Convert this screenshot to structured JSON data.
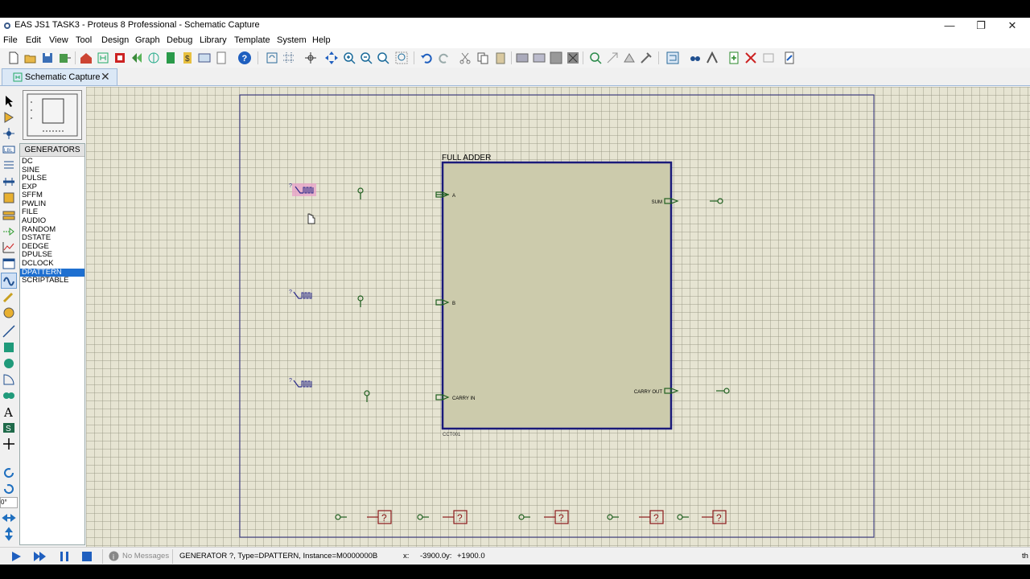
{
  "window": {
    "title": "EAS JS1 TASK3 - Proteus 8 Professional - Schematic Capture"
  },
  "menu": [
    "File",
    "Edit",
    "View",
    "Tool",
    "Design",
    "Graph",
    "Debug",
    "Library",
    "Template",
    "System",
    "Help"
  ],
  "tab": {
    "label": "Schematic Capture"
  },
  "generators": {
    "header": "GENERATORS",
    "items": [
      "DC",
      "SINE",
      "PULSE",
      "EXP",
      "SFFM",
      "PWLIN",
      "FILE",
      "AUDIO",
      "RANDOM",
      "DSTATE",
      "DEDGE",
      "DPULSE",
      "DCLOCK",
      "DPATTERN",
      "SCRIPTABLE"
    ],
    "selected": "DPATTERN"
  },
  "left_tools": {
    "rotation": "0°"
  },
  "schematic": {
    "block": {
      "title": "FULL ADDER",
      "ref": "CCT001"
    },
    "pins_in": [
      "A",
      "B",
      "CARRY IN"
    ],
    "pins_out": [
      "SUM",
      "CARRY OUT"
    ],
    "gen_prefix": "?",
    "unknown_part": "?"
  },
  "status": {
    "messages": "No Messages",
    "info": "GENERATOR ?, Type=DPATTERN, Instance=M0000000B",
    "x_label": "x:",
    "x_value": "-3900.0",
    "y_label": "y:",
    "y_value": "+1900.0",
    "right": "th"
  },
  "colors": {
    "canvas": "#e6e4d2",
    "block_border": "#1a1a7a",
    "block_fill": "#cccbac",
    "wire": "#1f5f1f",
    "part": "#8b1a1a",
    "selection": "#1e6fd0"
  }
}
